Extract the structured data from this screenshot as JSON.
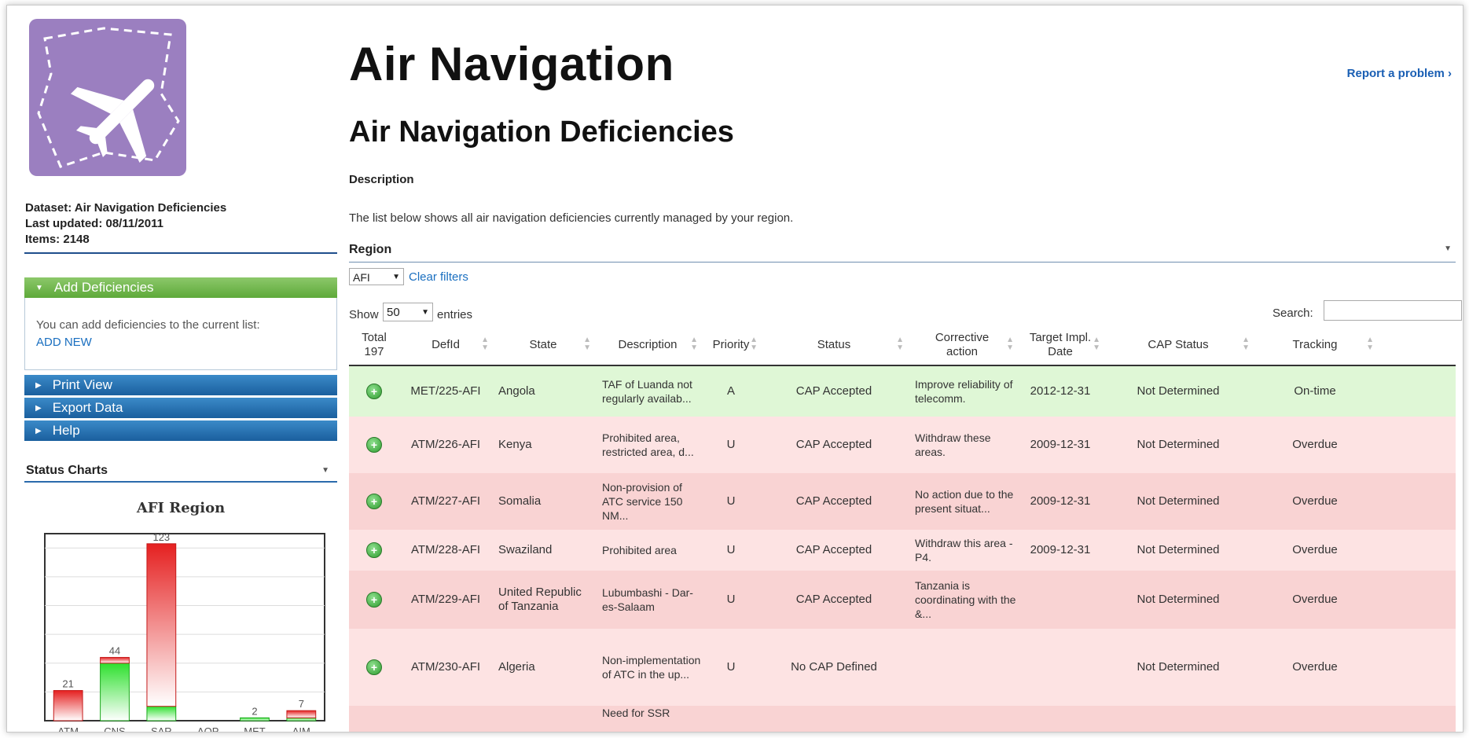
{
  "header": {
    "title": "Air Navigation",
    "subtitle": "Air Navigation Deficiencies",
    "report_link": "Report a problem ›"
  },
  "dataset": {
    "name": "Dataset: Air Navigation Deficiencies",
    "last_updated": "Last updated: 08/11/2011",
    "items": "Items: 2148"
  },
  "sidebar": {
    "add_header": "Add Deficiencies",
    "add_text": "You can add deficiencies to the current list:",
    "add_link": "ADD NEW",
    "print_view": "Print View",
    "export_data": "Export Data",
    "help": "Help",
    "status_charts": "Status Charts"
  },
  "main": {
    "description_label": "Description",
    "description_text": "The list below shows all air navigation deficiencies currently managed by your region.",
    "region_label": "Region",
    "region_value": "AFI",
    "clear_filters": "Clear filters",
    "show_label": "Show",
    "show_value": "50",
    "entries_label": "entries",
    "search_label": "Search:"
  },
  "table": {
    "headers": {
      "total": "Total",
      "total_count": "197",
      "defid": "DefId",
      "state": "State",
      "description": "Description",
      "priority": "Priority",
      "status": "Status",
      "corrective": "Corrective action",
      "target": "Target Impl. Date",
      "cap_status": "CAP Status",
      "tracking": "Tracking"
    },
    "rows": [
      {
        "defid": "MET/225-AFI",
        "state": "Angola",
        "description": "TAF of Luanda not regularly availab...",
        "priority": "A",
        "status": "CAP Accepted",
        "corrective": "Improve reliability of telecomm.",
        "target": "2012-12-31",
        "cap_status": "Not Determined",
        "tracking": "On-time"
      },
      {
        "defid": "ATM/226-AFI",
        "state": "Kenya",
        "description": "Prohibited area, restricted area, d...",
        "priority": "U",
        "status": "CAP Accepted",
        "corrective": "Withdraw these areas.",
        "target": "2009-12-31",
        "cap_status": "Not Determined",
        "tracking": "Overdue"
      },
      {
        "defid": "ATM/227-AFI",
        "state": "Somalia",
        "description": "Non-provision of ATC service 150 NM...",
        "priority": "U",
        "status": "CAP Accepted",
        "corrective": "No action due to the present situat...",
        "target": "2009-12-31",
        "cap_status": "Not Determined",
        "tracking": "Overdue"
      },
      {
        "defid": "ATM/228-AFI",
        "state": "Swaziland",
        "description": "Prohibited area",
        "priority": "U",
        "status": "CAP Accepted",
        "corrective": "Withdraw this area - P4.",
        "target": "2009-12-31",
        "cap_status": "Not Determined",
        "tracking": "Overdue"
      },
      {
        "defid": "ATM/229-AFI",
        "state": "United Republic of Tanzania",
        "description": "Lubumbashi - Dar-es-Salaam",
        "priority": "U",
        "status": "CAP Accepted",
        "corrective": "Tanzania is coordinating with the &...",
        "target": "",
        "cap_status": "Not Determined",
        "tracking": "Overdue"
      },
      {
        "defid": "ATM/230-AFI",
        "state": "Algeria",
        "description": "Non-implementation of ATC in the up...",
        "priority": "U",
        "status": "No CAP Defined",
        "corrective": "",
        "target": "",
        "cap_status": "Not Determined",
        "tracking": "Overdue"
      },
      {
        "defid": "",
        "state": "",
        "description": "Need for SSR",
        "priority": "",
        "status": "",
        "corrective": "",
        "target": "",
        "cap_status": "",
        "tracking": ""
      }
    ],
    "row_colors": [
      "#dff7d6",
      "#fde3e3",
      "#f9d3d3",
      "#fde3e3",
      "#f9d3d3",
      "#fde3e3",
      "#f9d3d3"
    ]
  },
  "chart_data": {
    "type": "bar",
    "title": "AFI Region",
    "categories": [
      "ATM",
      "CNS",
      "SAR",
      "AOP",
      "MET",
      "AIM"
    ],
    "totals": [
      21,
      44,
      123,
      0,
      2,
      7
    ],
    "series": [
      {
        "values": [
          0,
          40,
          10,
          0,
          2,
          2
        ],
        "color": "#2ecc2e"
      },
      {
        "values": [
          21,
          4,
          113,
          0,
          0,
          5
        ],
        "color": "#e53030"
      }
    ],
    "ylim": [
      0,
      130
    ],
    "grid": true
  }
}
